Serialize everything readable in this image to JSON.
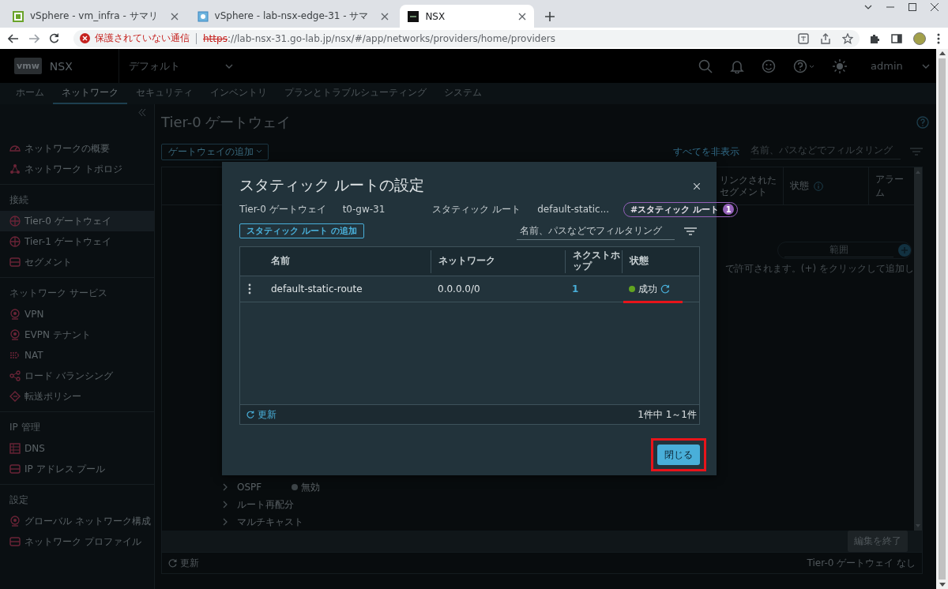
{
  "browser": {
    "tabs": [
      {
        "title": "vSphere - vm_infra - サマリ",
        "selected": false
      },
      {
        "title": "vSphere - lab-nsx-edge-31 - サマ",
        "selected": false
      },
      {
        "title": "NSX",
        "selected": true
      }
    ],
    "address": {
      "warning": "保護されていない通信",
      "scheme": "https",
      "rest": "://lab-nsx-31.go-lab.jp/nsx/#/app/networks/providers/home/providers"
    }
  },
  "header": {
    "logo": "vmw",
    "product": "NSX",
    "project": "デフォルト",
    "user": "admin"
  },
  "nav": [
    {
      "label": "ホーム",
      "selected": false
    },
    {
      "label": "ネットワーク",
      "selected": true
    },
    {
      "label": "セキュリティ",
      "selected": false
    },
    {
      "label": "インベントリ",
      "selected": false
    },
    {
      "label": "プランとトラブルシューティング",
      "selected": false
    },
    {
      "label": "システム",
      "selected": false
    }
  ],
  "sidebar": {
    "sections": [
      {
        "items": [
          {
            "label": "ネットワークの概要",
            "selected": false
          },
          {
            "label": "ネットワーク トポロジ",
            "selected": false
          }
        ]
      },
      {
        "heading": "接続",
        "items": [
          {
            "label": "Tier-0 ゲートウェイ",
            "selected": true
          },
          {
            "label": "Tier-1 ゲートウェイ",
            "selected": false
          },
          {
            "label": "セグメント",
            "selected": false
          }
        ]
      },
      {
        "heading": "ネットワーク サービス",
        "items": [
          {
            "label": "VPN",
            "selected": false
          },
          {
            "label": "EVPN テナント",
            "selected": false
          },
          {
            "label": "NAT",
            "selected": false
          },
          {
            "label": "ロード バランシング",
            "selected": false
          },
          {
            "label": "転送ポリシー",
            "selected": false
          }
        ]
      },
      {
        "heading": "IP 管理",
        "items": [
          {
            "label": "DNS",
            "selected": false
          },
          {
            "label": "IP アドレス プール",
            "selected": false
          }
        ]
      },
      {
        "heading": "設定",
        "items": [
          {
            "label": "グローバル ネットワーク構成",
            "selected": false
          },
          {
            "label": "ネットワーク プロファイル",
            "selected": false
          }
        ]
      }
    ]
  },
  "main": {
    "title": "Tier-0 ゲートウェイ",
    "add_button": "ゲートウェイの追加",
    "collapse_all": "すべてを非表示",
    "filter_placeholder": "名前、パスなどでフィルタリング",
    "columns": [
      "リンクされたセグメント",
      "状態",
      "アラーム"
    ],
    "range_placeholder": "範囲",
    "hint": "で許可されます。(+) をクリックして追加し",
    "sections": [
      {
        "label": "OSPF",
        "status": "無効"
      },
      {
        "label": "ルート再配分"
      },
      {
        "label": "マルチキャスト"
      }
    ],
    "done_button": "編集を終了",
    "refresh": "更新",
    "footer_note": "Tier-0 ゲートウェイ なし"
  },
  "modal": {
    "title": "スタティック ルートの設定",
    "breadcrumb": [
      {
        "label": "Tier-0 ゲートウェイ",
        "value": "t0-gw-31"
      },
      {
        "label": "スタティック ルート",
        "value": "default-static..."
      }
    ],
    "tag": {
      "label": "#スタティック ルート",
      "count": "1"
    },
    "add_button": "スタティック ルート の追加",
    "filter_placeholder": "名前、パスなどでフィルタリング",
    "columns": [
      "名前",
      "ネットワーク",
      "ネクストホップ",
      "状態"
    ],
    "rows": [
      {
        "name": "default-static-route",
        "network": "0.0.0.0/0",
        "next_hops": "1",
        "status": {
          "label": "成功",
          "kind": "success"
        },
        "underlined": true
      }
    ],
    "refresh": "更新",
    "count": "1件中 1～1件",
    "close_button": {
      "label": "閉じる",
      "highlighted": true
    }
  }
}
